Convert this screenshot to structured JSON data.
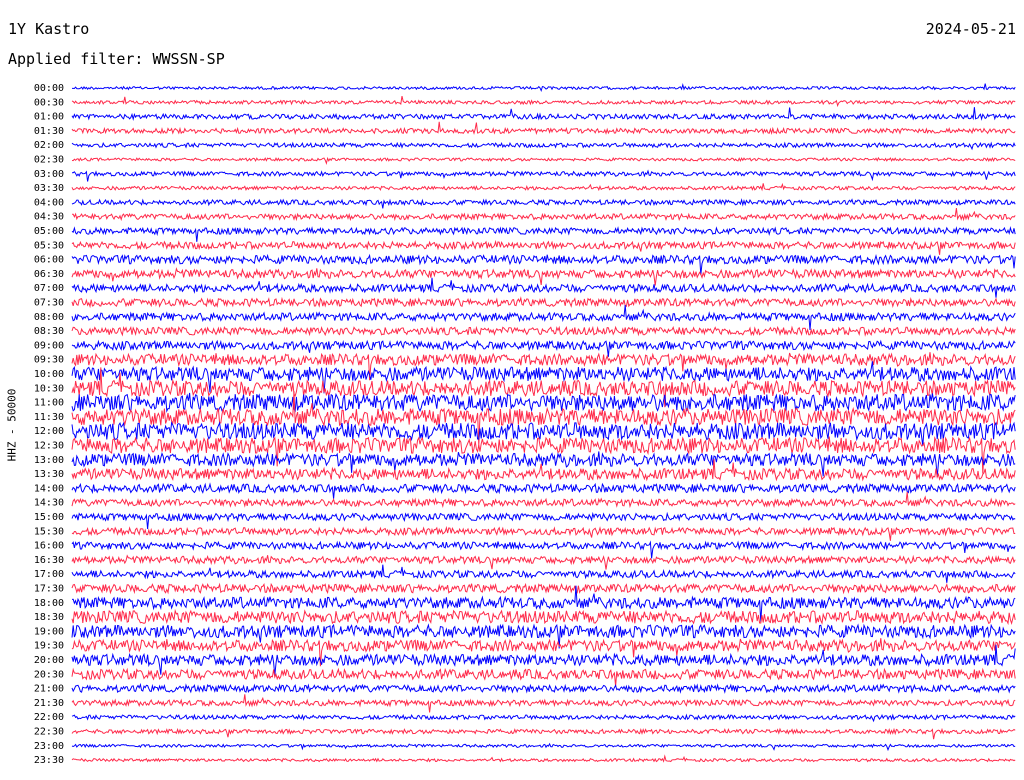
{
  "header": {
    "station": "1Y Kastro",
    "date": "2024-05-21",
    "filter": "Applied filter: WWSSN-SP",
    "channel_label": "HHZ - 50000"
  },
  "colors": {
    "even": "#0000ff",
    "odd": "#ff2a4a"
  },
  "chart_data": {
    "type": "line",
    "title": "1Y Kastro",
    "subtitle": "Applied filter: WWSSN-SP",
    "ylabel": "HHZ - 50000",
    "row_labels": [
      "00:00",
      "00:30",
      "01:00",
      "01:30",
      "02:00",
      "02:30",
      "03:00",
      "03:30",
      "04:00",
      "04:30",
      "05:00",
      "05:30",
      "06:00",
      "06:30",
      "07:00",
      "07:30",
      "08:00",
      "08:30",
      "09:00",
      "09:30",
      "10:00",
      "10:30",
      "11:00",
      "11:30",
      "12:00",
      "12:30",
      "13:00",
      "13:30",
      "14:00",
      "14:30",
      "15:00",
      "15:30",
      "16:00",
      "16:30",
      "17:00",
      "17:30",
      "18:00",
      "18:30",
      "19:00",
      "19:30",
      "20:00",
      "20:30",
      "21:00",
      "21:30",
      "22:00",
      "22:30",
      "23:00",
      "23:30"
    ],
    "row_amplitude": [
      0.2,
      0.25,
      0.35,
      0.35,
      0.3,
      0.2,
      0.3,
      0.25,
      0.35,
      0.4,
      0.45,
      0.5,
      0.6,
      0.6,
      0.55,
      0.55,
      0.55,
      0.55,
      0.6,
      0.8,
      1.0,
      1.1,
      1.2,
      1.2,
      1.2,
      1.1,
      0.9,
      0.8,
      0.6,
      0.5,
      0.5,
      0.5,
      0.5,
      0.5,
      0.5,
      0.6,
      0.8,
      0.9,
      0.9,
      0.8,
      0.8,
      0.7,
      0.5,
      0.4,
      0.3,
      0.3,
      0.2,
      0.2
    ],
    "grid": false
  }
}
